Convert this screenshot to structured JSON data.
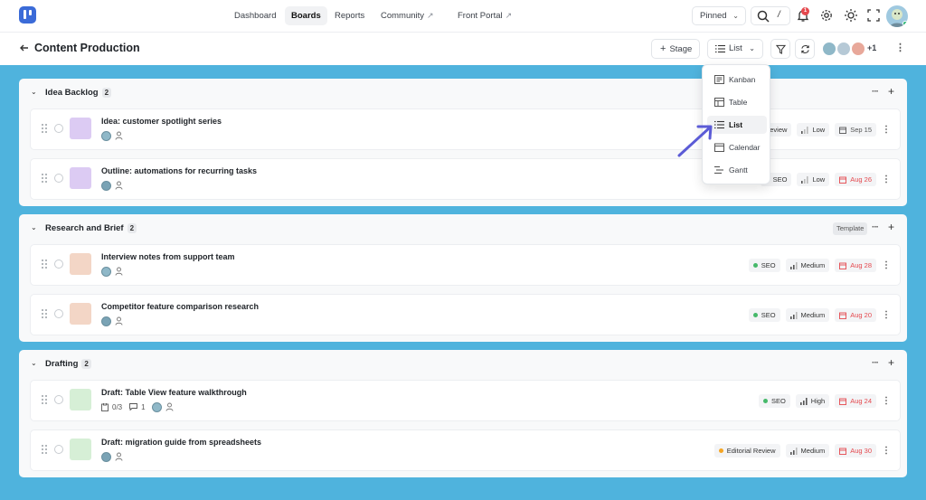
{
  "nav": {
    "items": [
      {
        "label": "Dashboard"
      },
      {
        "label": "Boards"
      },
      {
        "label": "Reports"
      },
      {
        "label": "Community",
        "external": "↗"
      },
      {
        "label": "Front Portal",
        "external": "↗"
      }
    ],
    "pinned_label": "Pinned",
    "search_shortcut": "/",
    "notification_count": "1"
  },
  "board": {
    "title": "Content Production",
    "stage_label": "Stage",
    "view_label": "List",
    "members_more": "+1"
  },
  "view_menu": [
    {
      "label": "Kanban",
      "icon": "kanban-icon"
    },
    {
      "label": "Table",
      "icon": "table-icon"
    },
    {
      "label": "List",
      "icon": "list-icon",
      "selected": true
    },
    {
      "label": "Calendar",
      "icon": "calendar-icon"
    },
    {
      "label": "Gantt",
      "icon": "gantt-icon"
    }
  ],
  "groups": [
    {
      "title": "Idea Backlog",
      "count": "2",
      "template": "",
      "rows": [
        {
          "title": "Idea: customer spotlight series",
          "thumb": "#dccbf3",
          "tag": "eview",
          "tag_dot": "",
          "priority": "Low",
          "date": "Sep 15",
          "date_color": "#555555"
        },
        {
          "title": "Outline: automations for recurring tasks",
          "thumb": "#dccbf3",
          "tag": "SEO",
          "tag_dot": "#46b96a",
          "priority": "Low",
          "date": "Aug 26",
          "date_color": "#e5484d"
        }
      ]
    },
    {
      "title": "Research and Brief",
      "count": "2",
      "template": "Template",
      "rows": [
        {
          "title": "Interview notes from support team",
          "thumb": "#f3d6c6",
          "tag": "SEO",
          "tag_dot": "#46b96a",
          "priority": "Medium",
          "date": "Aug 28",
          "date_color": "#e5484d"
        },
        {
          "title": "Competitor feature comparison research",
          "thumb": "#f3d6c6",
          "tag": "SEO",
          "tag_dot": "#46b96a",
          "priority": "Medium",
          "date": "Aug 20",
          "date_color": "#e5484d"
        }
      ]
    },
    {
      "title": "Drafting",
      "count": "2",
      "template": "",
      "rows": [
        {
          "title": "Draft: Table View feature walkthrough",
          "thumb": "#d6efd6",
          "checklist": "0/3",
          "comments": "1",
          "tag": "SEO",
          "tag_dot": "#46b96a",
          "priority": "High",
          "date": "Aug 24",
          "date_color": "#e5484d"
        },
        {
          "title": "Draft: migration guide from spreadsheets",
          "thumb": "#d6efd6",
          "tag": "Editorial Review",
          "tag_dot": "#f5a524",
          "priority": "Medium",
          "date": "Aug 30",
          "date_color": "#e5484d"
        }
      ]
    }
  ],
  "colors": {
    "accent": "#3b6bd8",
    "background": "#4fb3dd",
    "annotation_arrow": "#5b5bd6"
  }
}
